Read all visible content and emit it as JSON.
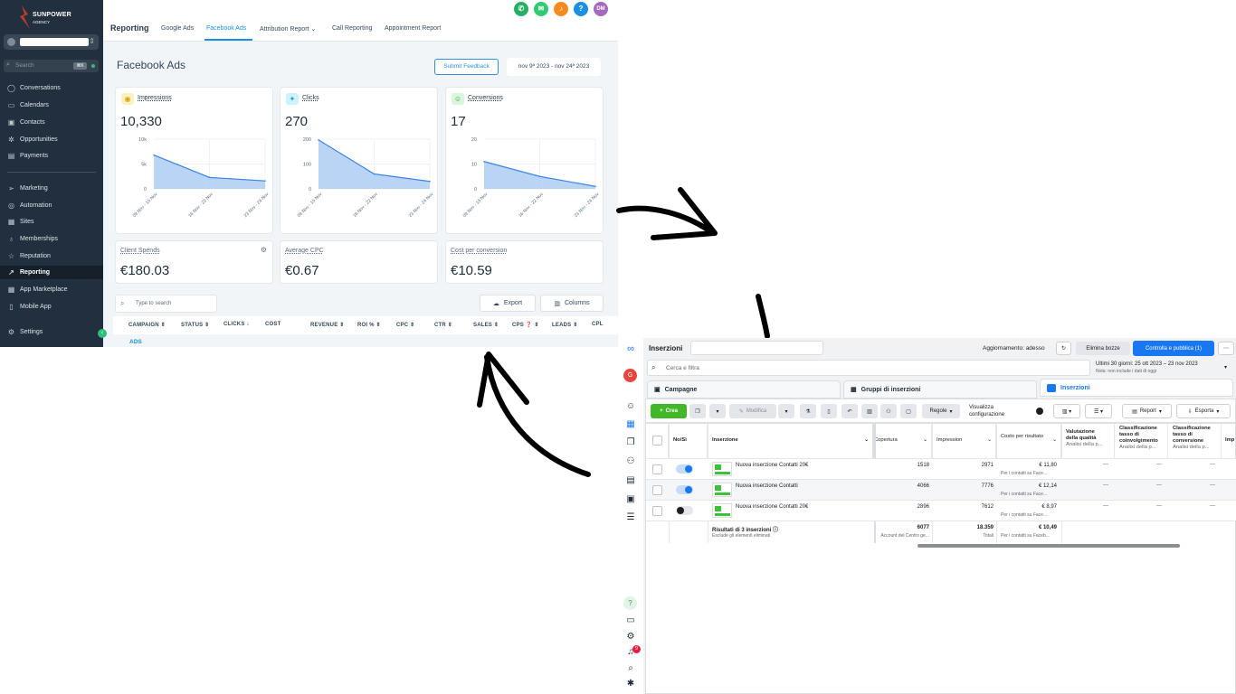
{
  "crm": {
    "brand": {
      "name": "SUNPOWER",
      "sub": "AGENCY"
    },
    "search": {
      "placeholder": "Search",
      "shortcut": "⌘K"
    },
    "nav": [
      {
        "label": "Conversations",
        "icon": "chat-icon"
      },
      {
        "label": "Calendars",
        "icon": "calendar-icon"
      },
      {
        "label": "Contacts",
        "icon": "contacts-icon"
      },
      {
        "label": "Opportunities",
        "icon": "opportunities-icon"
      },
      {
        "label": "Payments",
        "icon": "payments-icon"
      },
      {
        "label": "Marketing",
        "icon": "send-icon"
      },
      {
        "label": "Automation",
        "icon": "automation-icon"
      },
      {
        "label": "Sites",
        "icon": "sites-icon"
      },
      {
        "label": "Memberships",
        "icon": "memberships-icon"
      },
      {
        "label": "Reputation",
        "icon": "star-icon"
      },
      {
        "label": "Reporting",
        "icon": "trend-icon"
      },
      {
        "label": "App Marketplace",
        "icon": "grid-icon"
      },
      {
        "label": "Mobile App",
        "icon": "phone-icon"
      },
      {
        "label": "Settings",
        "icon": "gear-icon"
      }
    ],
    "topbar": {
      "title": "Reporting",
      "tabs": [
        "Google Ads",
        "Facebook Ads",
        "Attribution Report",
        "Call Reporting",
        "Appointment Report"
      ],
      "active_tab": "Facebook Ads",
      "avatar": "DM",
      "icon_colors": [
        "#27ae60",
        "#2ecc71",
        "#f58b1f",
        "#1d8fe1",
        "#9b59b6"
      ]
    },
    "page_title": "Facebook Ads",
    "submit_feedback": "Submit Feedback",
    "date_range": "nov 9ª 2023 - nov 24ª 2023",
    "metric_cards": [
      {
        "label": "Impressions",
        "value": "10,330",
        "color": "#f7d24c",
        "ymax": 10000,
        "yticks": [
          "10k",
          "5k",
          "0"
        ],
        "series": [
          6800,
          2300,
          1600
        ]
      },
      {
        "label": "Clicks",
        "value": "270",
        "color": "#45c8e8",
        "ymax": 200,
        "yticks": [
          "200",
          "100",
          "0"
        ],
        "series": [
          197,
          60,
          30
        ]
      },
      {
        "label": "Conversions",
        "value": "17",
        "color": "#5fd16a",
        "ymax": 20,
        "yticks": [
          "20",
          "10",
          "0"
        ],
        "series": [
          11,
          5,
          1
        ]
      }
    ],
    "chart_x": [
      "09 Nov - 15 Nov",
      "16 Nov - 22 Nov",
      "23 Nov - 24 Nov"
    ],
    "stat_cards": [
      {
        "label": "Client Spends",
        "value": "€180.03"
      },
      {
        "label": "Average CPC",
        "value": "€0.67"
      },
      {
        "label": "Cost per conversion",
        "value": "€10.59"
      }
    ],
    "table_search_placeholder": "Type to search",
    "export_label": "Export",
    "columns_label": "Columns",
    "table_headers": [
      "CAMPAIGN ⇕",
      "STATUS ⇕",
      "CLICKS ↓",
      "COST",
      "REVENUE ⇕",
      "ROI % ⇕",
      "CPC ⇕",
      "CTR ⇕",
      "SALES ⇕",
      "CPS ❓ ⇕",
      "LEADS ⇕",
      "CPL"
    ],
    "first_row": "ADS"
  },
  "meta": {
    "title": "Inserzioni",
    "updated": "Aggiornamento: adesso",
    "discard": "Elimina bozze",
    "publish": "Controlla e pubblica (1)",
    "search_placeholder": "Cerca e filtra",
    "date_range": "Ultimi 30 giorni: 25 ott 2023 – 23 nov 2023",
    "date_note": "Nota: non include i dati di oggi",
    "tabs": [
      "Campagne",
      "Gruppi di inserzioni",
      "Inserzioni"
    ],
    "toolbar": {
      "create": "Crea",
      "edit": "Modifica",
      "rules": "Regole",
      "view": "Visualizza configurazione",
      "report": "Report",
      "export": "Esporta"
    },
    "headers": {
      "onoff": "No/Sì",
      "ad": "Inserzione",
      "reach": "Copertura",
      "impressions": "Impression",
      "cost": "Costo per risultato",
      "quality": "Valutazione della qualità",
      "quality_sub": "Analisi della p...",
      "engagement": "Classificazione tasso di coinvolgimento",
      "engagement_sub": "Analisi della p...",
      "conversion": "Classificazione tasso di conversione",
      "conversion_sub": "Analisi della p...",
      "more": "Imp"
    },
    "rows": [
      {
        "name": "Nuova inserzione Contatti 20€",
        "on": true,
        "reach": "1518",
        "impressions": "2971",
        "cost": "€ 11,80",
        "cost_sub": "Per i contatti su Face...",
        "q": "—",
        "e": "—",
        "c": "—"
      },
      {
        "name": "Nuova inserzione Contatti",
        "on": true,
        "reach": "4066",
        "impressions": "7776",
        "cost": "€ 12,14",
        "cost_sub": "Per i contatti su Face...",
        "q": "—",
        "e": "—",
        "c": "—"
      },
      {
        "name": "Nuova inserzione Contatti 20€",
        "on": false,
        "reach": "2896",
        "impressions": "7612",
        "cost": "€ 8,97",
        "cost_sub": "Per i contatti su Face...",
        "q": "—",
        "e": "—",
        "c": "—"
      }
    ],
    "totals": {
      "label": "Risultati di 3 inserzioni",
      "sub": "Esclude gli elementi eliminati",
      "reach": "6077",
      "reach_sub": "Account del Centro ge...",
      "impressions": "18.359",
      "impressions_sub": "Totali",
      "cost": "€ 10,49",
      "cost_sub": "Per i contatti su Faceb..."
    },
    "user_initial": "G",
    "notif_count": "9"
  }
}
